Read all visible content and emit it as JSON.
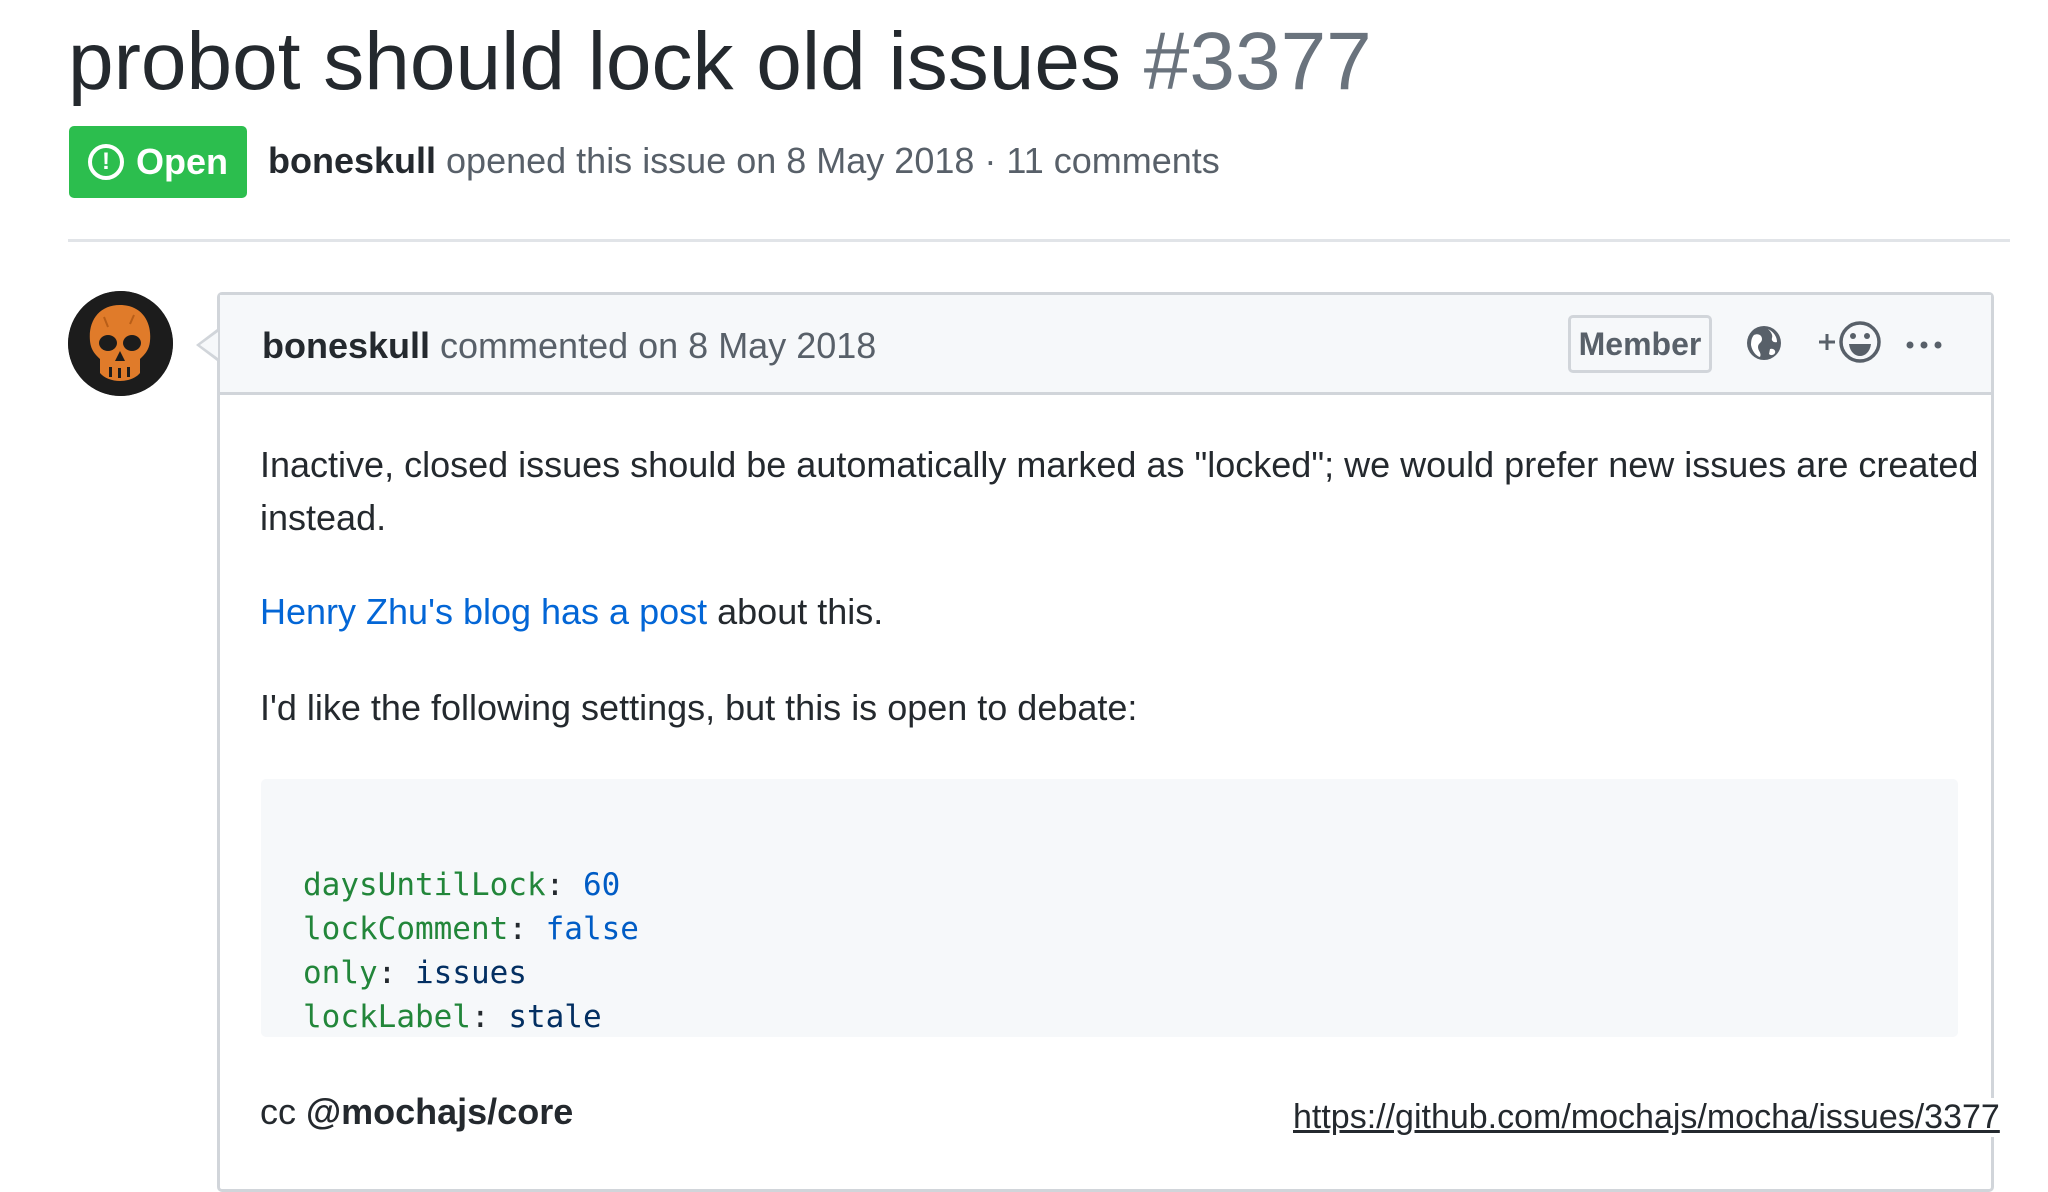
{
  "issue": {
    "title": "probot should lock old issues",
    "number": "#3377",
    "status_label": "Open",
    "status_color": "#2cbe4e",
    "author": "boneskull",
    "meta_text": " opened this issue on 8 May 2018 · 11 comments"
  },
  "comment": {
    "author": "boneskull",
    "date_text": " commented on 8 May 2018",
    "role_badge": "Member",
    "header_icons": [
      "globe-icon",
      "add-reaction-icon",
      "more-options-icon"
    ],
    "paragraph1_line1": "Inactive, closed issues should be automatically marked as \"locked\"; we would prefer new issues are created",
    "paragraph1_line2": "instead.",
    "link_text": "Henry Zhu's blog has a post",
    "after_link": " about this.",
    "paragraph3": "I'd like the following settings, but this is open to debate:",
    "code": [
      {
        "key": "daysUntilLock",
        "value": "60"
      },
      {
        "key": "lockComment",
        "value": "false"
      },
      {
        "key": "only",
        "value": "issues"
      },
      {
        "key": "lockLabel",
        "value": "stale"
      }
    ],
    "cc_prefix": "cc ",
    "cc_mention": "@mochajs/core"
  },
  "footer_url": "https://github.com/mochajs/mocha/issues/3377",
  "colors": {
    "link": "#0366d6",
    "code_key": "#22863a",
    "code_value": "#005cc5",
    "avatar_skull": "#e07b2a"
  }
}
